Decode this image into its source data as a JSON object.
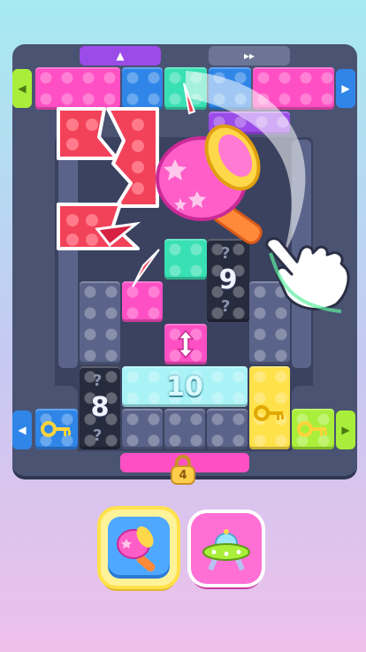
{
  "board": {
    "numbers": {
      "block_nine": "9",
      "block_ten": "10",
      "block_eight": "8"
    },
    "top_gate_arrow": "▲",
    "top_right_arrows": "▸▸",
    "left_side_arrow": "◀",
    "right_side_arrow": "▶",
    "lock_count": "4"
  },
  "boosters": {
    "hammer": {
      "icon": "hammer-icon"
    },
    "ufo": {
      "icon": "ufo-icon"
    }
  },
  "colors": {
    "red": "#f2425a",
    "pink": "#ff4fc4",
    "blue": "#2f86e8",
    "mint": "#39e0b4",
    "cyan": "#a9f3f7",
    "yellow": "#ffe14a",
    "lime": "#a9ee3a",
    "black": "#262b3d",
    "purple": "#9b4be8",
    "slate": "#5a648a"
  }
}
